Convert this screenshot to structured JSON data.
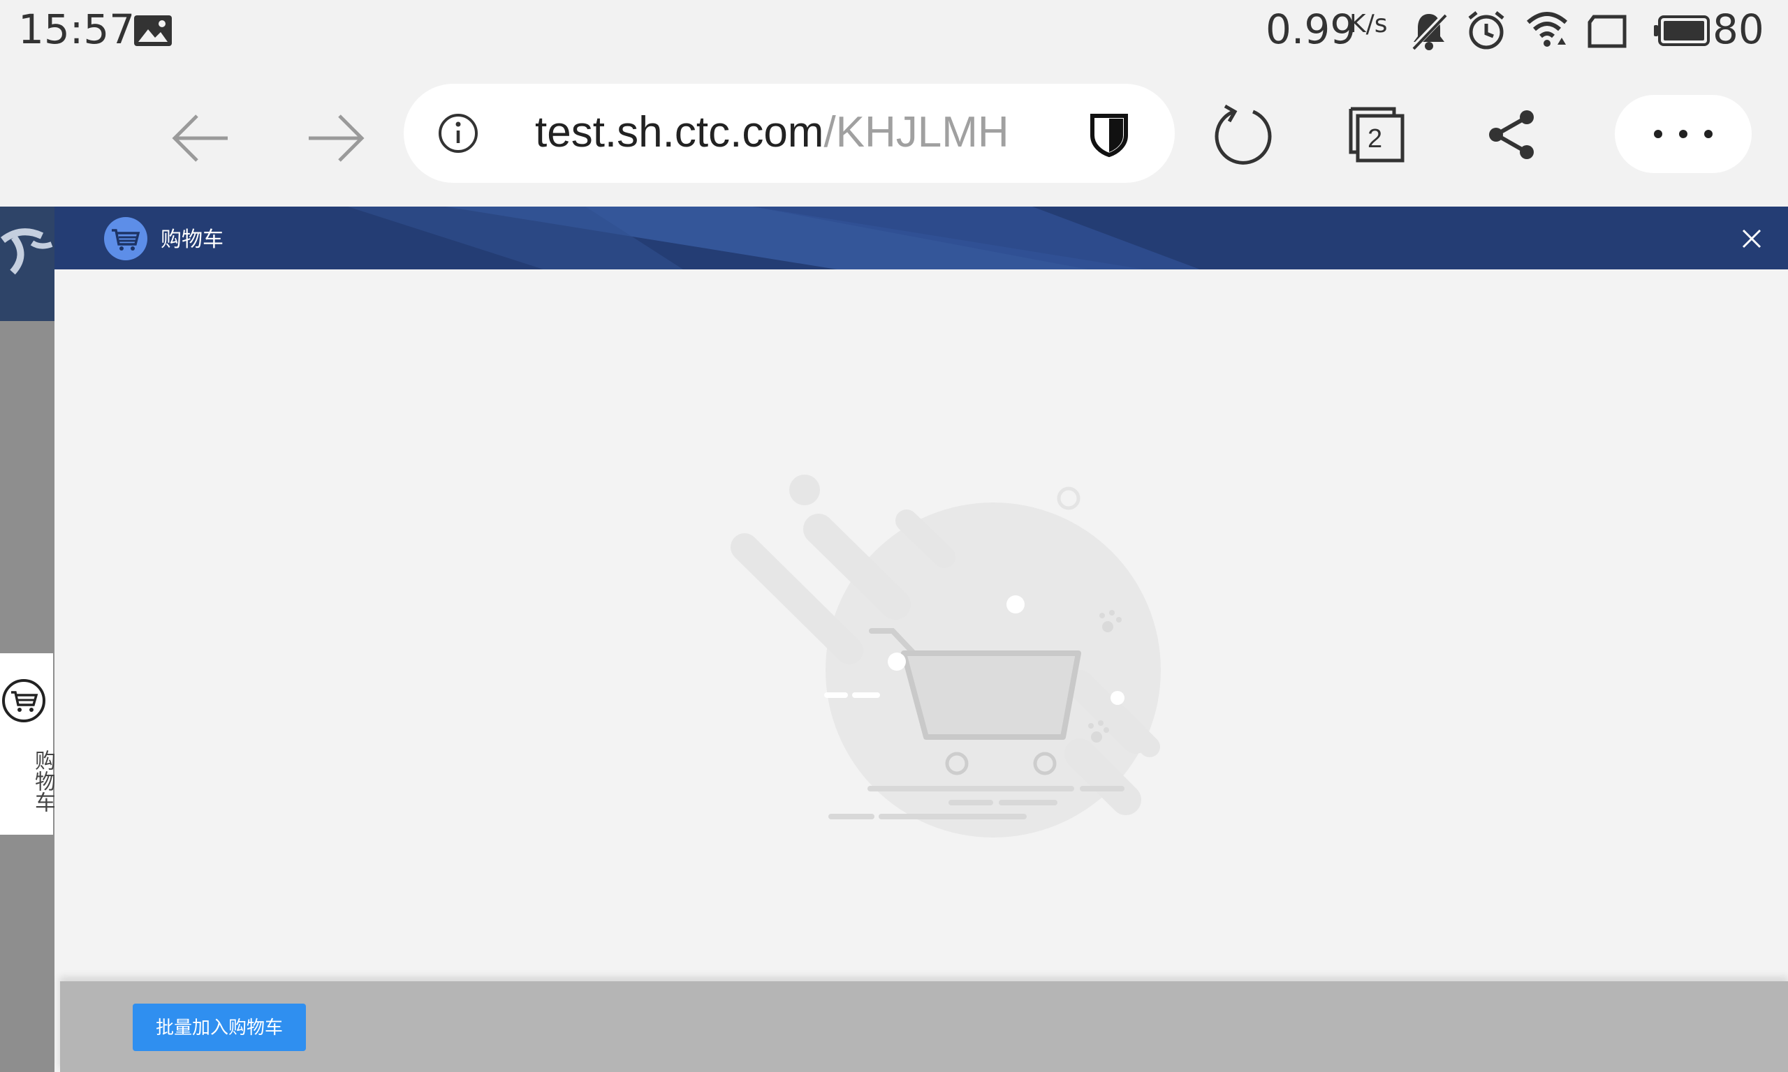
{
  "status_bar": {
    "time": "15:57",
    "network_speed": "0.99",
    "network_speed_unit": "K/s",
    "battery": "80",
    "icons": [
      "photo-icon",
      "mute-icon",
      "alarm-icon",
      "wifi-icon",
      "screen-rotate-icon",
      "battery-icon"
    ]
  },
  "browser": {
    "url_host": "test.sh.ctc.com",
    "url_path": "/KHJLMH",
    "tab_count": "2",
    "icons": [
      "back-arrow-icon",
      "forward-arrow-icon",
      "info-icon",
      "shield-icon",
      "refresh-icon",
      "tabs-icon",
      "share-icon",
      "more-icon"
    ]
  },
  "sidebar": {
    "cart_label": "购物车"
  },
  "modal": {
    "title": "购物车",
    "batch_add_button": "批量加入购物车",
    "header_color": "#243d74",
    "button_color": "#2f8ff0"
  }
}
